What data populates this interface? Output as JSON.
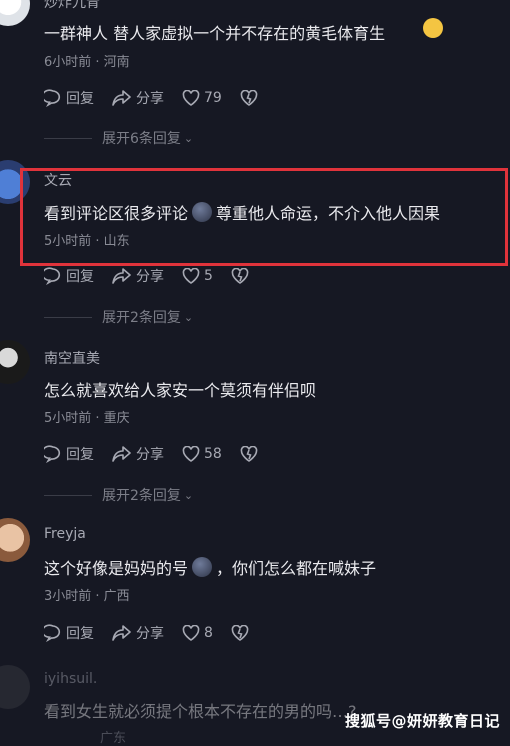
{
  "comments": [
    {
      "username": "炒炸九青",
      "text": "一群神人 替人家虚拟一个并不存在的黄毛体育生",
      "meta": "6小时前 · 河南",
      "reply": "回复",
      "share": "分享",
      "likes": "79",
      "expand": "展开6条回复"
    },
    {
      "username": "文云",
      "text_a": "看到评论区很多评论",
      "text_b": "尊重他人命运，不介入他人因果",
      "meta": "5小时前 · 山东",
      "reply": "回复",
      "share": "分享",
      "likes": "5",
      "expand": "展开2条回复"
    },
    {
      "username": "南空直美",
      "text": "怎么就喜欢给人家安一个莫须有伴侣呗",
      "meta": "5小时前 · 重庆",
      "reply": "回复",
      "share": "分享",
      "likes": "58",
      "expand": "展开2条回复"
    },
    {
      "username": "Freyja",
      "text_a": "这个好像是妈妈的号",
      "text_b": "，你们怎么都在喊妹子",
      "meta": "3小时前 · 广西",
      "reply": "回复",
      "share": "分享",
      "likes": "8"
    },
    {
      "username": "iyihsuil.",
      "text": "看到女生就必须提个根本不存在的男的吗…?",
      "meta": "广东"
    }
  ],
  "watermark": "搜狐号@妍妍教育日记",
  "colors": {
    "highlight": "#e0333b",
    "background": "#161823"
  }
}
